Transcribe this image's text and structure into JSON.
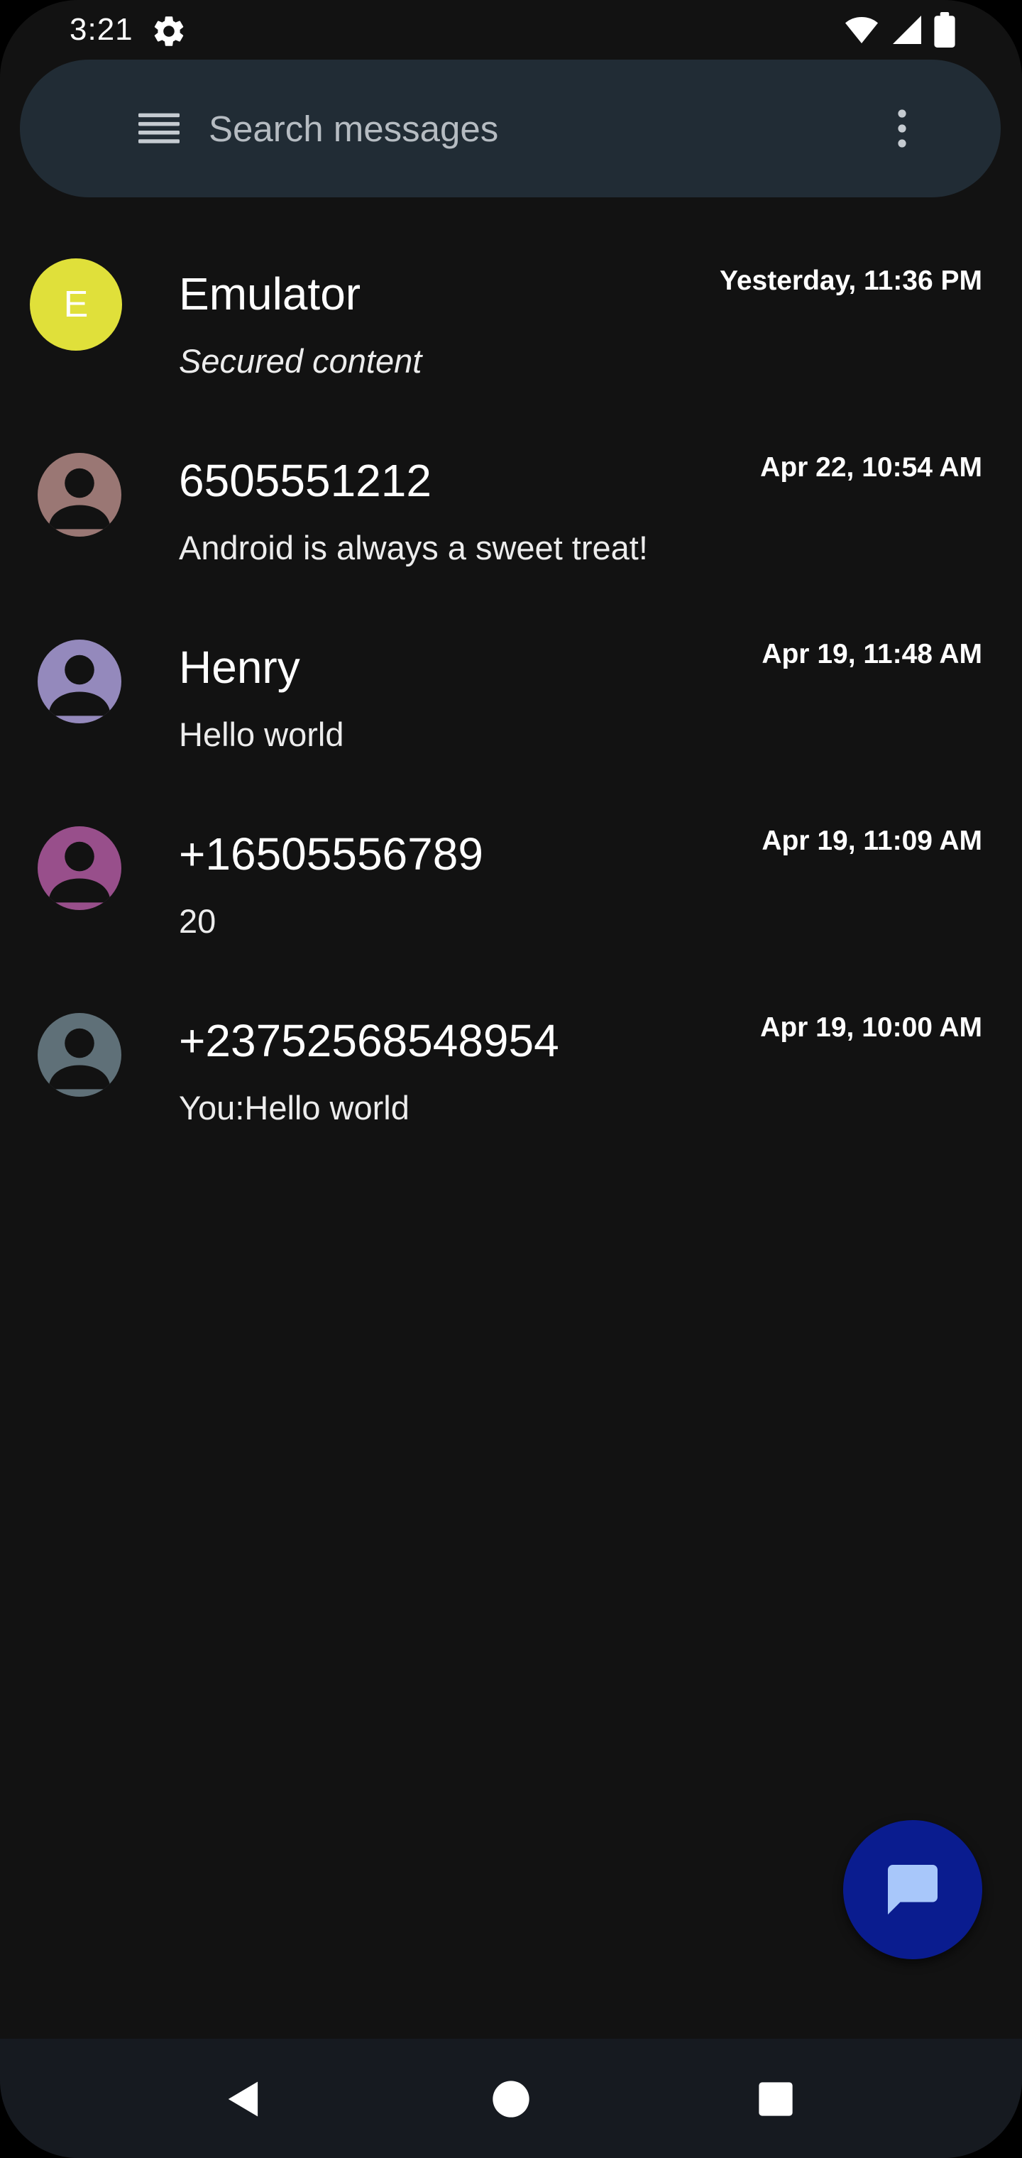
{
  "status_bar": {
    "time": "3:21",
    "icons": [
      "settings-gear-icon",
      "wifi-icon",
      "cell-signal-icon",
      "battery-icon"
    ]
  },
  "search": {
    "placeholder": "Search messages",
    "menu_icon": "hamburger-menu-icon",
    "more_icon": "more-vert-icon"
  },
  "conversations": [
    {
      "name": "Emulator",
      "time": "Yesterday, 11:36 PM",
      "snippet": "Secured content",
      "snippet_italic": true,
      "avatar_letter": "E",
      "avatar_color": "#e0e03a"
    },
    {
      "name": "6505551212",
      "time": "Apr 22, 10:54 AM",
      "snippet": "Android is always a sweet treat!",
      "avatar_icon": "person-icon",
      "avatar_color": "#9a7774"
    },
    {
      "name": "Henry",
      "time": "Apr 19, 11:48 AM",
      "snippet": "Hello world",
      "avatar_icon": "person-icon",
      "avatar_color": "#9489bc"
    },
    {
      "name": "+16505556789",
      "time": "Apr 19, 11:09 AM",
      "snippet": "20",
      "avatar_icon": "person-icon",
      "avatar_color": "#984f8b"
    },
    {
      "name": "+23752568548954",
      "time": "Apr 19, 10:00 AM",
      "snippet": "You:Hello world",
      "avatar_icon": "person-icon",
      "avatar_color": "#5f7078"
    }
  ],
  "fab": {
    "icon": "chat-bubble-icon",
    "background": "#0a1c8f",
    "icon_color": "#a8c7fa"
  },
  "nav_bar": {
    "buttons": [
      "back-icon",
      "home-icon",
      "recents-icon"
    ]
  }
}
